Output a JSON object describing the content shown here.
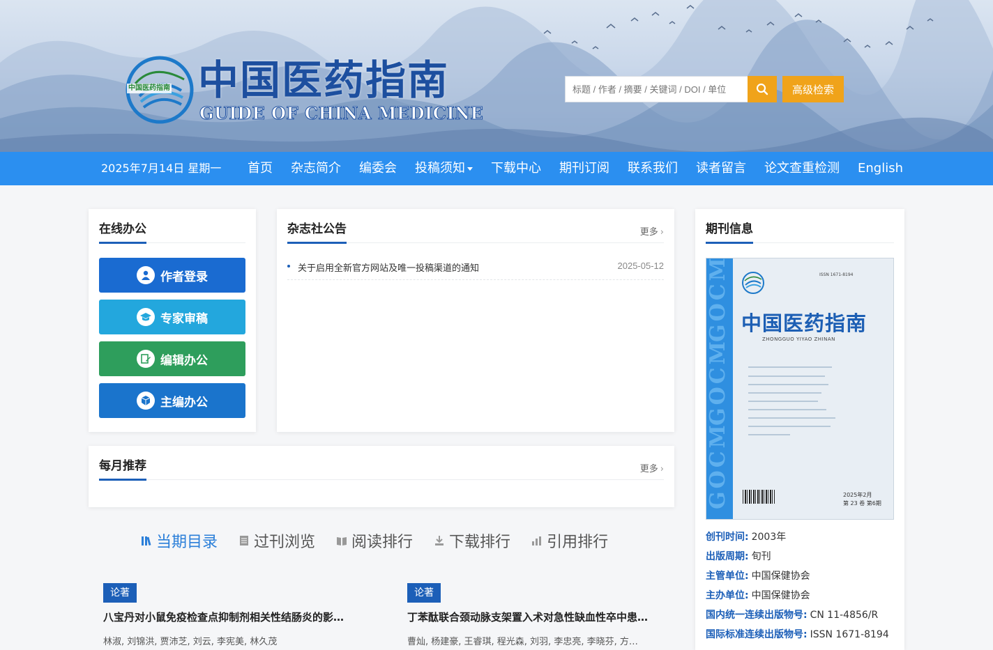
{
  "banner": {
    "logo_cn": "中国医药指南",
    "logo_en": "GUIDE OF CHINA MEDICINE",
    "logo_badge": "中国医药指南",
    "search_placeholder": "标题 / 作者 / 摘要 / 关键词 / DOI / 单位",
    "search_icon": "search-icon",
    "advanced_label": "高级检索"
  },
  "nav": {
    "date": "2025年7月14日 星期一",
    "items": [
      "首页",
      "杂志简介",
      "编委会",
      "投稿须知",
      "下载中心",
      "期刊订阅",
      "联系我们",
      "读者留言",
      "论文查重检测",
      "English"
    ]
  },
  "office": {
    "title": "在线办公",
    "buttons": [
      {
        "label": "作者登录",
        "icon": "user-icon",
        "color": "#1a6bd1"
      },
      {
        "label": "专家审稿",
        "icon": "graduation-cap-icon",
        "color": "#23a7dd"
      },
      {
        "label": "编辑办公",
        "icon": "edit-icon",
        "color": "#2e9e5c"
      },
      {
        "label": "主编办公",
        "icon": "cube-icon",
        "color": "#1a74cc"
      }
    ]
  },
  "notice": {
    "title": "杂志社公告",
    "more": "更多",
    "items": [
      {
        "text": "关于启用全新官方网站及唯一投稿渠道的通知",
        "date": "2025-05-12"
      }
    ]
  },
  "monthly": {
    "title": "每月推荐",
    "more": "更多"
  },
  "tabs": [
    {
      "label": "当期目录",
      "icon": "books-icon",
      "active": true
    },
    {
      "label": "过刊浏览",
      "icon": "document-icon",
      "active": false
    },
    {
      "label": "阅读排行",
      "icon": "book-icon",
      "active": false
    },
    {
      "label": "下载排行",
      "icon": "download-icon",
      "active": false
    },
    {
      "label": "引用排行",
      "icon": "bar-chart-icon",
      "active": false
    }
  ],
  "articles": [
    {
      "tag": "论著",
      "title": "八宝丹对小鼠免疫检查点抑制剂相关性结肠炎的影…",
      "authors": "林淑, 刘锦洪, 贾沛芝, 刘云, 李宪美, 林久茂"
    },
    {
      "tag": "论著",
      "title": "丁苯酞联合颈动脉支架置入术对急性缺血性卒中患…",
      "authors": "曹灿, 杨建豪, 王睿琪, 程光森, 刘羽, 李忠亮, 李晓芬, 方…"
    }
  ],
  "journal": {
    "title": "期刊信息",
    "cover": {
      "title": "中国医药指南",
      "sub": "ZHONGGUO YIYAO ZHINAN",
      "issn_line": "ISSN 1671-8194",
      "date": "2025年2月",
      "vol": "第 23 卷  第6期",
      "strip_text": "GOCM"
    },
    "info": [
      {
        "key": "创刊时间:",
        "val": "2003年"
      },
      {
        "key": "出版周期:",
        "val": "旬刊"
      },
      {
        "key": "主管单位:",
        "val": "中国保健协会"
      },
      {
        "key": "主办单位:",
        "val": "中国保健协会"
      },
      {
        "key": "国内统一连续出版物号:",
        "val": "CN 11-4856/R"
      },
      {
        "key": "国际标准连续出版物号:",
        "val": "ISSN 1671-8194"
      }
    ]
  },
  "colors": {
    "nav": "#2b8ff0",
    "accent": "#f0a31a",
    "brand": "#1c5fb8"
  }
}
